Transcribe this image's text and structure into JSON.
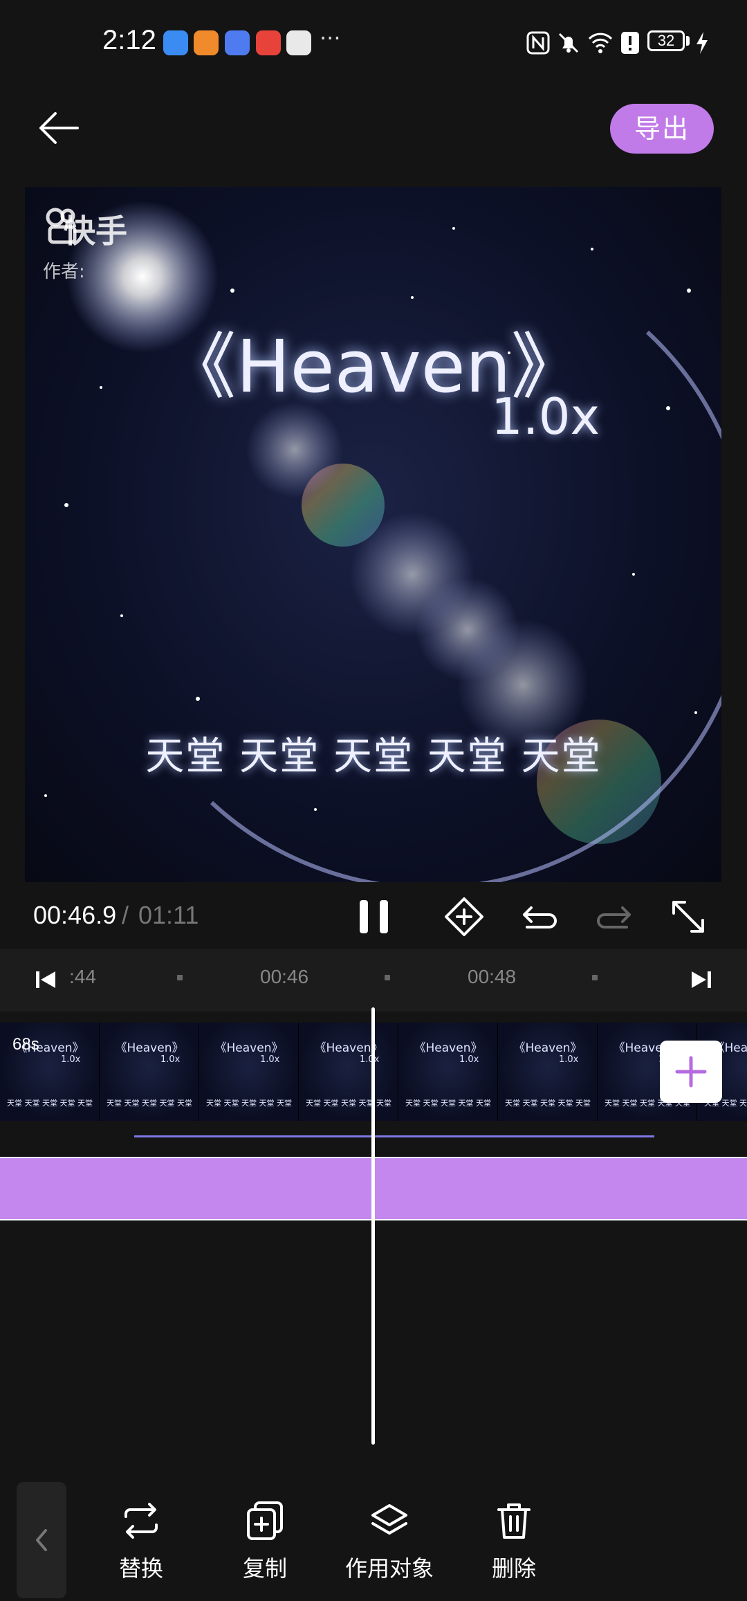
{
  "status_bar": {
    "time": "2:12",
    "overflow": "···",
    "battery": "32"
  },
  "header": {
    "back_icon": "arrow-left-icon",
    "export_label": "导出"
  },
  "preview": {
    "logo_text": "快手",
    "author_text": "作者: ",
    "title": "《Heaven》",
    "speed": "1.0x",
    "lyrics": "天堂 天堂 天堂 天堂 天堂"
  },
  "playback": {
    "current_time": "00:46.9",
    "separator": "/",
    "total_time": "01:11"
  },
  "ruler": {
    "labels": [
      ":44",
      "00:46",
      "00:48"
    ]
  },
  "timeline": {
    "clip_duration": "68s",
    "frame_title": "《Heaven》",
    "frame_speed": "1.0x",
    "frame_lyrics": "天堂 天堂 天堂 天堂 天堂"
  },
  "toolbar": {
    "items": [
      {
        "label": "替换",
        "icon": "replace-icon"
      },
      {
        "label": "复制",
        "icon": "copy-icon"
      },
      {
        "label": "作用对象",
        "icon": "layers-icon"
      },
      {
        "label": "删除",
        "icon": "trash-icon"
      }
    ]
  },
  "colors": {
    "accent": "#c07be8",
    "track": "#c487ee",
    "audio_line": "#7f79e6",
    "background": "#141414"
  }
}
